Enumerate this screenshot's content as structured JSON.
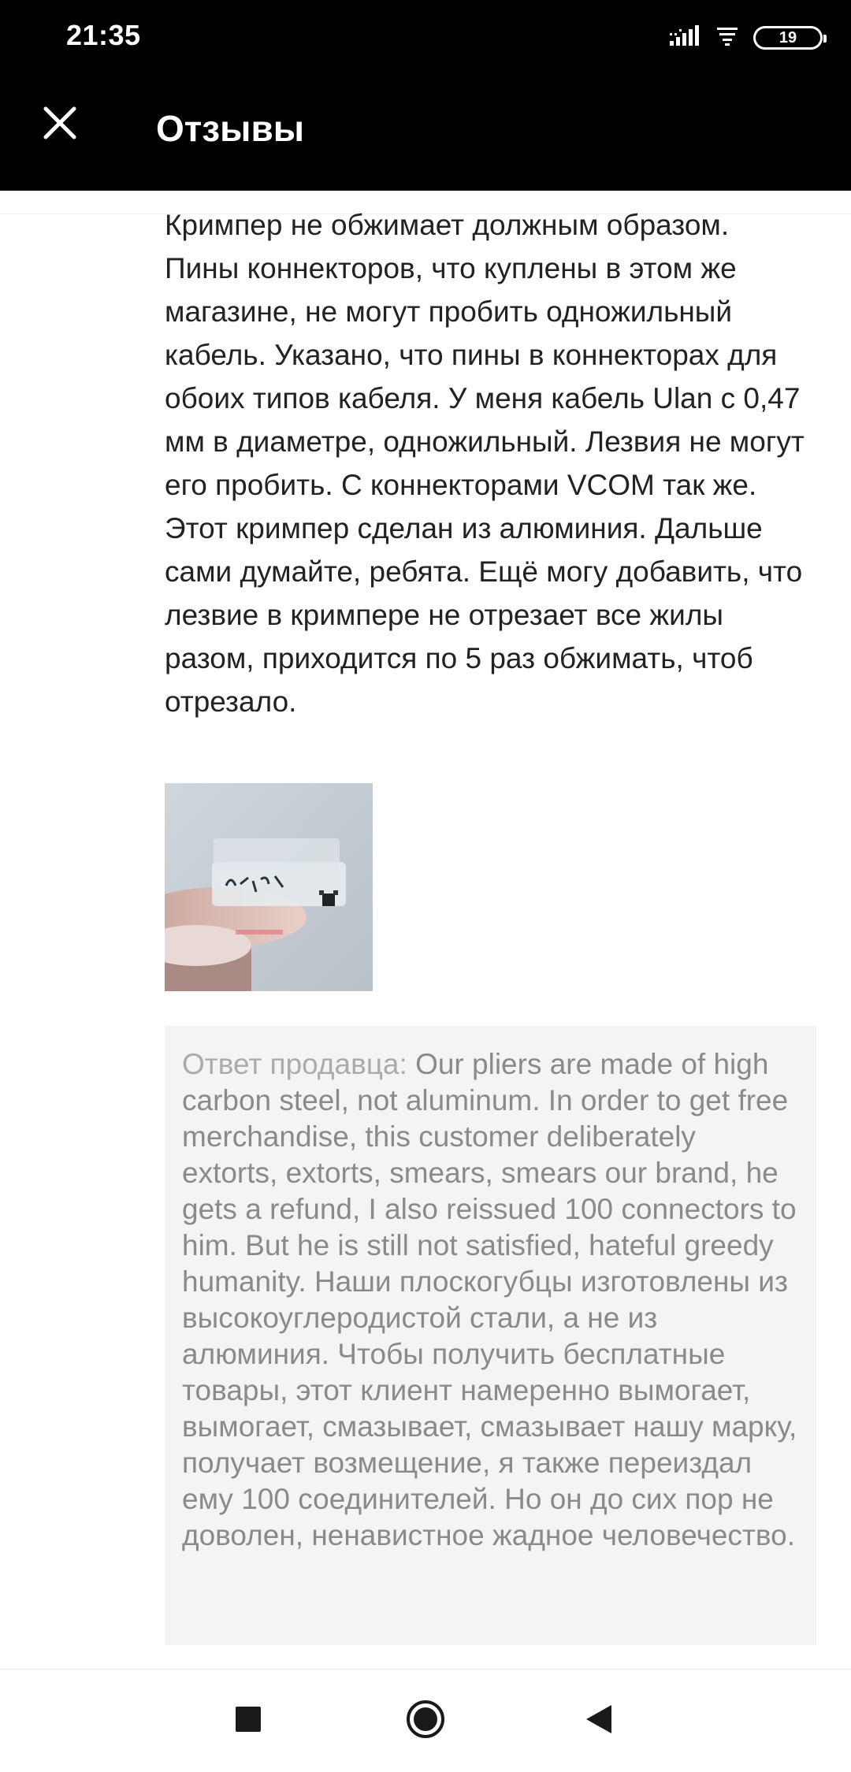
{
  "status_bar": {
    "time": "21:35",
    "battery_level": "19",
    "icons": [
      "signal-icon",
      "wifi-icon",
      "battery-icon"
    ]
  },
  "app_bar": {
    "title": "Отзывы",
    "close_icon": "close-icon"
  },
  "review": {
    "text": "Кримпер не обжимает должным образом. Пины коннекторов, что куплены в этом же магазине, не могут пробить одножильный кабель. Указано, что пины в коннекторах для обоих типов кабеля. У меня кабель Ulan с 0,47 мм в диаметре, одножильный. Лезвия не могут его пробить. С коннекторами VCOM так же. Этот кримпер сделан из алюминия. Дальше сами думайте, ребята. Ещё могу добавить, что лезвие в кримпере не отрезает все жилы разом, приходится по 5 раз обжимать, чтоб отрезало.",
    "photo": {
      "handwritten_text": "5Е ЛПЛ5"
    }
  },
  "seller_reply": {
    "label": "Ответ продавца:",
    "text": "Our pliers are made of high carbon steel, not aluminum. In order to get free merchandise, this customer deliberately extorts, extorts, smears, smears our brand, he gets a refund, I also reissued 100 connectors to him. But he is still not satisfied, hateful greedy humanity. Наши плоскогубцы изготовлены из высокоуглеродистой стали, а не из алюминия. Чтобы получить бесплатные товары, этот клиент намеренно вымогает, вымогает, смазывает, смазывает нашу марку, получает возмещение, я также переиздал ему 100 соединителей. Но он до сих пор не доволен, ненавистное жадное человечество."
  },
  "nav_bar": {
    "buttons": [
      "recents-square-icon",
      "home-circle-icon",
      "back-triangle-icon"
    ]
  },
  "colors": {
    "bar_background": "#000000",
    "text_primary": "#222222",
    "reply_background": "#f4f4f4",
    "reply_text": "#8a8a8a"
  }
}
